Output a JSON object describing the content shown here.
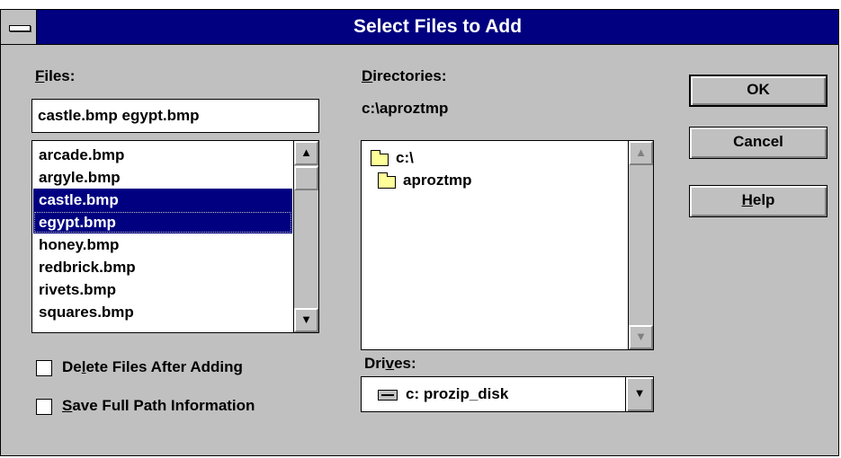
{
  "window": {
    "title": "Select Files to Add"
  },
  "files": {
    "label_prefix": "",
    "label_accel": "F",
    "label_rest": "iles:",
    "input_value": "castle.bmp egypt.bmp",
    "items": [
      {
        "name": "arcade.bmp",
        "selected": false
      },
      {
        "name": "argyle.bmp",
        "selected": false
      },
      {
        "name": "castle.bmp",
        "selected": true
      },
      {
        "name": "egypt.bmp",
        "selected": true
      },
      {
        "name": "honey.bmp",
        "selected": false
      },
      {
        "name": "redbrick.bmp",
        "selected": false
      },
      {
        "name": "rivets.bmp",
        "selected": false
      },
      {
        "name": "squares.bmp",
        "selected": false
      }
    ]
  },
  "directories": {
    "label_accel": "D",
    "label_rest": "irectories:",
    "current_path": "c:\\aproztmp",
    "items": [
      {
        "name": "c:\\",
        "icon": "open-folder-icon"
      },
      {
        "name": "aproztmp",
        "icon": "open-folder-icon"
      }
    ]
  },
  "drives": {
    "label_prefix": "Dri",
    "label_accel": "v",
    "label_rest": "es:",
    "selected": "c: prozip_disk",
    "icon": "drive-icon"
  },
  "buttons": {
    "ok": "OK",
    "cancel": "Cancel",
    "help_accel": "H",
    "help_rest": "elp"
  },
  "options": {
    "delete_prefix": "De",
    "delete_accel": "l",
    "delete_rest": "ete Files After Adding",
    "delete_checked": false,
    "save_prefix": "",
    "save_accel": "S",
    "save_rest": "ave Full Path Information",
    "save_checked": false
  },
  "colors": {
    "title_bar": "#000080",
    "dialog_bg": "#c0c0c0",
    "selection": "#000080"
  },
  "scroll_glyphs": {
    "up": "▲",
    "down": "▼",
    "combo": "▼"
  }
}
